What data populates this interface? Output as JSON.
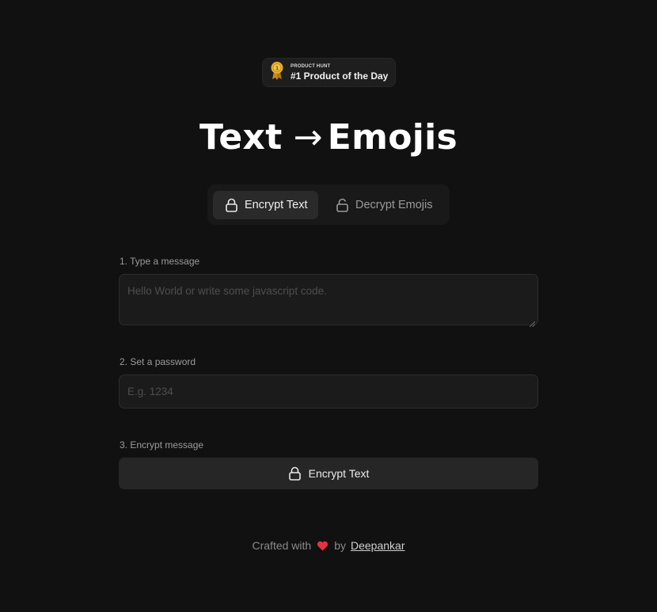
{
  "badge": {
    "small": "PRODUCT HUNT",
    "big": "#1 Product of the Day",
    "icon": "medal-icon"
  },
  "title": {
    "left": "Text",
    "arrow": "→",
    "right": "Emojis"
  },
  "tabs": [
    {
      "label": "Encrypt Text",
      "icon": "lock-icon",
      "active": true
    },
    {
      "label": "Decrypt Emojis",
      "icon": "unlock-icon",
      "active": false
    }
  ],
  "form": {
    "message_label": "1. Type a message",
    "message_placeholder": "Hello World or write some javascript code.",
    "message_value": "",
    "password_label": "2. Set a password",
    "password_placeholder": "E.g. 1234",
    "password_value": "",
    "encrypt_label": "3. Encrypt message",
    "encrypt_button": "Encrypt Text"
  },
  "footer": {
    "prefix": "Crafted with",
    "by": "by",
    "author": "Deepankar"
  },
  "colors": {
    "background": "#111111",
    "surface": "#1b1b1b",
    "heart": "#e5323c",
    "medal": "#e0a526"
  }
}
